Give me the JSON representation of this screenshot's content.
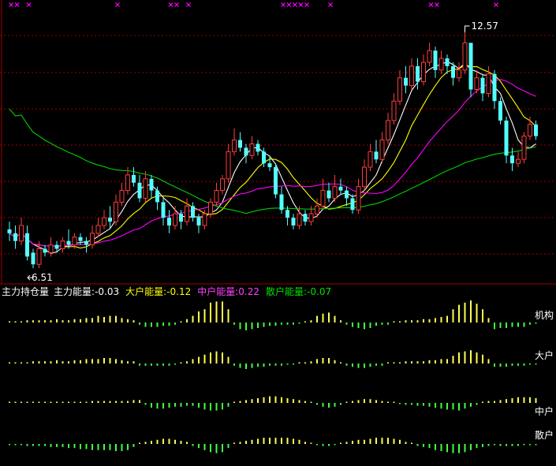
{
  "colors": {
    "up": "#ff3c3c",
    "down": "#54ffff",
    "ma_white": "#ffffff",
    "ma_yellow": "#ffff00",
    "ma_magenta": "#ff00ff",
    "ma_green": "#00d000",
    "grid": "#a00000",
    "signal": "#ff00ff",
    "bar_pos": "#ffff50",
    "bar_neg": "#40ff40"
  },
  "annotations": {
    "high_label": "12.57",
    "low_label": "6.51"
  },
  "indicator_header": {
    "title": "主力持仓量",
    "items": [
      {
        "label": "主力能量:",
        "value": "-0.03",
        "color": "#ffffff"
      },
      {
        "label": "大户能量:",
        "value": "-0.12",
        "color": "#ffff00"
      },
      {
        "label": "中户能量:",
        "value": "0.22",
        "color": "#ff40ff"
      },
      {
        "label": "散户能量:",
        "value": "-0.07",
        "color": "#00e000"
      }
    ]
  },
  "panel_labels": [
    "机构",
    "大户",
    "中户",
    "散户"
  ],
  "chart_data": [
    {
      "type": "candlestick",
      "ylim": [
        6.3,
        13.2
      ],
      "high": 12.57,
      "low": 6.51,
      "candles": [
        [
          7.5,
          7.4,
          7.7,
          7.2
        ],
        [
          7.4,
          7.2,
          7.6,
          7.0
        ],
        [
          7.2,
          7.6,
          7.8,
          7.1
        ],
        [
          7.4,
          6.8,
          7.6,
          6.7
        ],
        [
          6.9,
          6.6,
          7.0,
          6.5
        ],
        [
          6.6,
          7.0,
          7.2,
          6.5
        ],
        [
          7.0,
          6.9,
          7.1,
          6.8
        ],
        [
          6.9,
          7.1,
          7.3,
          6.8
        ],
        [
          7.1,
          7.0,
          7.2,
          6.9
        ],
        [
          7.0,
          7.2,
          7.3,
          6.9
        ],
        [
          7.2,
          7.1,
          7.5,
          7.0
        ],
        [
          7.1,
          7.3,
          7.4,
          7.0
        ],
        [
          7.3,
          7.2,
          7.4,
          7.1
        ],
        [
          7.2,
          7.1,
          7.3,
          6.9
        ],
        [
          7.1,
          7.4,
          7.6,
          7.0
        ],
        [
          7.4,
          7.6,
          7.8,
          7.3
        ],
        [
          7.6,
          7.8,
          8.0,
          7.5
        ],
        [
          7.8,
          7.7,
          8.1,
          7.5
        ],
        [
          7.7,
          8.2,
          8.4,
          7.6
        ],
        [
          8.2,
          8.5,
          8.7,
          8.1
        ],
        [
          8.5,
          8.9,
          9.1,
          8.4
        ],
        [
          8.9,
          8.7,
          9.1,
          8.6
        ],
        [
          8.7,
          8.3,
          8.9,
          8.2
        ],
        [
          8.3,
          8.8,
          9.0,
          8.2
        ],
        [
          8.8,
          8.5,
          8.9,
          8.3
        ],
        [
          8.5,
          8.2,
          8.6,
          8.0
        ],
        [
          8.2,
          7.8,
          8.3,
          7.6
        ],
        [
          7.8,
          7.6,
          8.0,
          7.4
        ],
        [
          7.6,
          7.9,
          8.1,
          7.5
        ],
        [
          7.9,
          7.7,
          8.0,
          7.5
        ],
        [
          7.7,
          8.1,
          8.3,
          7.6
        ],
        [
          8.1,
          7.8,
          8.2,
          7.7
        ],
        [
          7.8,
          7.6,
          7.9,
          7.4
        ],
        [
          7.6,
          7.9,
          8.0,
          7.5
        ],
        [
          7.9,
          8.2,
          8.3,
          7.8
        ],
        [
          8.2,
          8.5,
          8.7,
          8.1
        ],
        [
          8.5,
          8.8,
          8.9,
          8.4
        ],
        [
          8.8,
          9.5,
          9.7,
          8.7
        ],
        [
          9.5,
          9.8,
          10.1,
          9.4
        ],
        [
          9.8,
          9.6,
          10.0,
          9.5
        ],
        [
          9.6,
          9.4,
          9.7,
          9.2
        ],
        [
          9.4,
          9.7,
          9.9,
          9.3
        ],
        [
          9.7,
          9.5,
          9.8,
          9.4
        ],
        [
          9.5,
          9.2,
          9.6,
          9.1
        ],
        [
          9.2,
          9.1,
          9.4,
          9.0
        ],
        [
          9.1,
          8.4,
          9.2,
          8.3
        ],
        [
          8.4,
          8.0,
          8.6,
          7.9
        ],
        [
          8.0,
          7.8,
          8.1,
          7.6
        ],
        [
          7.8,
          7.6,
          7.9,
          7.5
        ],
        [
          7.6,
          7.9,
          8.1,
          7.5
        ],
        [
          7.9,
          7.7,
          8.0,
          7.6
        ],
        [
          7.7,
          7.9,
          8.1,
          7.6
        ],
        [
          7.9,
          8.1,
          8.3,
          7.8
        ],
        [
          8.1,
          8.5,
          8.8,
          8.0
        ],
        [
          8.5,
          8.3,
          8.7,
          8.2
        ],
        [
          8.3,
          8.6,
          8.9,
          8.2
        ],
        [
          8.6,
          8.5,
          8.8,
          8.4
        ],
        [
          8.5,
          8.3,
          8.6,
          8.1
        ],
        [
          8.3,
          8.0,
          8.4,
          7.9
        ],
        [
          8.0,
          8.6,
          8.8,
          7.9
        ],
        [
          8.6,
          9.1,
          9.3,
          8.5
        ],
        [
          9.1,
          9.5,
          9.7,
          9.0
        ],
        [
          9.5,
          9.3,
          9.8,
          9.2
        ],
        [
          9.3,
          9.8,
          10.0,
          9.2
        ],
        [
          9.8,
          10.3,
          10.5,
          9.7
        ],
        [
          10.3,
          10.8,
          11.0,
          10.2
        ],
        [
          10.8,
          11.4,
          11.6,
          10.7
        ],
        [
          11.4,
          11.2,
          11.7,
          11.0
        ],
        [
          11.2,
          11.7,
          11.9,
          11.1
        ],
        [
          11.7,
          11.3,
          11.9,
          11.1
        ],
        [
          11.3,
          11.8,
          12.0,
          11.2
        ],
        [
          11.8,
          12.1,
          12.3,
          11.7
        ],
        [
          12.1,
          11.6,
          12.2,
          11.4
        ],
        [
          11.6,
          11.9,
          12.1,
          11.5
        ],
        [
          11.9,
          11.7,
          12.0,
          11.5
        ],
        [
          11.7,
          11.4,
          11.8,
          11.2
        ],
        [
          11.4,
          11.6,
          11.8,
          11.3
        ],
        [
          11.6,
          12.3,
          12.57,
          11.5
        ],
        [
          12.3,
          11.1,
          12.3,
          10.9
        ],
        [
          11.1,
          11.4,
          11.6,
          11.0
        ],
        [
          11.4,
          11.0,
          11.5,
          10.8
        ],
        [
          11.0,
          11.5,
          11.7,
          10.9
        ],
        [
          11.5,
          10.8,
          11.6,
          10.6
        ],
        [
          10.8,
          10.3,
          10.9,
          10.2
        ],
        [
          10.3,
          9.4,
          10.4,
          9.2
        ],
        [
          9.4,
          9.2,
          9.6,
          9.0
        ],
        [
          9.2,
          9.3,
          9.5,
          9.1
        ],
        [
          9.3,
          9.9,
          10.0,
          9.2
        ],
        [
          9.9,
          10.2,
          10.4,
          9.8
        ],
        [
          10.2,
          9.9,
          10.3,
          9.8
        ]
      ]
    },
    {
      "type": "bar",
      "series": [
        {
          "name": "机构",
          "values": [
            0.05,
            0.05,
            0.05,
            0.1,
            0.1,
            0.1,
            0.1,
            0.1,
            0.15,
            0.1,
            0.1,
            0.15,
            0.15,
            0.2,
            0.2,
            0.3,
            0.25,
            0.3,
            0.3,
            0.2,
            0.15,
            0.1,
            -0.1,
            -0.2,
            -0.2,
            -0.2,
            -0.15,
            -0.15,
            -0.1,
            0.05,
            0.15,
            0.3,
            0.5,
            0.6,
            0.9,
            0.95,
            0.95,
            0.6,
            -0.1,
            -0.3,
            -0.35,
            -0.3,
            -0.25,
            -0.2,
            -0.15,
            -0.15,
            -0.1,
            -0.1,
            -0.1,
            -0.05,
            0.05,
            0.1,
            0.3,
            0.4,
            0.45,
            0.3,
            0.1,
            -0.1,
            -0.2,
            -0.25,
            -0.3,
            -0.25,
            -0.15,
            -0.1,
            -0.1,
            0.05,
            0.05,
            0.1,
            0.1,
            0.1,
            0.15,
            0.15,
            0.2,
            0.25,
            0.3,
            0.6,
            0.8,
            0.9,
            1.0,
            0.85,
            0.6,
            0.2,
            -0.3,
            -0.25,
            -0.25,
            -0.2,
            -0.2,
            -0.2,
            -0.1,
            -0.05
          ]
        },
        {
          "name": "大户",
          "values": [
            0.05,
            0.05,
            0.05,
            0.05,
            0.1,
            0.1,
            0.1,
            0.1,
            0.15,
            0.1,
            0.1,
            0.15,
            0.15,
            0.2,
            0.2,
            0.2,
            0.25,
            0.25,
            0.2,
            0.15,
            0.1,
            0.1,
            -0.1,
            -0.1,
            -0.1,
            -0.1,
            -0.1,
            -0.1,
            -0.05,
            0.05,
            0.1,
            0.2,
            0.3,
            0.4,
            0.5,
            0.55,
            0.5,
            0.3,
            -0.1,
            -0.2,
            -0.25,
            -0.2,
            -0.15,
            -0.15,
            -0.1,
            -0.1,
            -0.1,
            -0.05,
            -0.05,
            0.05,
            0.05,
            0.1,
            0.2,
            0.25,
            0.25,
            0.15,
            0.05,
            -0.1,
            -0.15,
            -0.2,
            -0.2,
            -0.15,
            -0.1,
            -0.1,
            0.05,
            0.05,
            0.05,
            0.1,
            0.1,
            0.1,
            0.1,
            0.15,
            0.15,
            0.2,
            0.2,
            0.35,
            0.5,
            0.55,
            0.6,
            0.5,
            0.4,
            0.2,
            -0.15,
            -0.15,
            -0.15,
            -0.1,
            -0.1,
            -0.1,
            -0.05,
            -0.05
          ]
        },
        {
          "name": "中户",
          "values": [
            0.05,
            0.05,
            0.05,
            0.05,
            0.05,
            0.05,
            0.05,
            0.05,
            0.05,
            0.05,
            0.05,
            0.05,
            0.05,
            0.05,
            0.1,
            0.1,
            0.1,
            0.1,
            0.1,
            0.1,
            0.1,
            0.15,
            0.15,
            -0.1,
            -0.25,
            -0.3,
            -0.3,
            -0.25,
            -0.2,
            -0.2,
            -0.15,
            -0.15,
            -0.25,
            -0.35,
            -0.4,
            -0.4,
            -0.35,
            -0.2,
            0.05,
            0.1,
            0.15,
            0.2,
            0.25,
            0.3,
            0.35,
            0.35,
            0.3,
            0.25,
            0.2,
            0.15,
            0.1,
            0.05,
            -0.1,
            -0.2,
            -0.25,
            -0.2,
            -0.1,
            0.05,
            0.1,
            0.15,
            0.2,
            0.2,
            0.15,
            0.1,
            0.05,
            0.05,
            -0.05,
            -0.1,
            -0.1,
            -0.15,
            -0.15,
            -0.2,
            -0.25,
            -0.3,
            -0.35,
            -0.35,
            -0.4,
            -0.3,
            -0.2,
            -0.1,
            0.05,
            0.1,
            0.1,
            0.15,
            0.2,
            0.25,
            0.3,
            0.3,
            0.3,
            0.25
          ]
        },
        {
          "name": "散户",
          "values": [
            -0.05,
            -0.05,
            -0.05,
            -0.1,
            -0.1,
            -0.1,
            -0.1,
            -0.15,
            -0.15,
            -0.15,
            -0.2,
            -0.2,
            -0.25,
            -0.25,
            -0.3,
            -0.3,
            -0.3,
            -0.3,
            -0.35,
            -0.35,
            -0.3,
            -0.15,
            0.05,
            0.1,
            0.15,
            0.2,
            0.25,
            0.25,
            0.2,
            0.15,
            0.1,
            -0.1,
            -0.2,
            -0.3,
            -0.4,
            -0.45,
            -0.4,
            -0.2,
            0.05,
            0.1,
            0.15,
            0.2,
            0.25,
            0.3,
            0.3,
            0.3,
            0.3,
            0.3,
            0.25,
            0.2,
            0.1,
            0.05,
            -0.05,
            -0.1,
            -0.1,
            -0.05,
            0.05,
            0.1,
            0.15,
            0.2,
            0.2,
            0.25,
            0.3,
            0.3,
            0.3,
            0.25,
            0.2,
            0.1,
            0.05,
            -0.1,
            -0.15,
            -0.2,
            -0.3,
            -0.35,
            -0.4,
            -0.45,
            -0.45,
            -0.4,
            -0.3,
            -0.2,
            -0.15,
            -0.1,
            -0.05,
            -0.1,
            -0.1,
            -0.1,
            -0.1,
            -0.05,
            -0.05,
            -0.05
          ]
        }
      ]
    }
  ]
}
